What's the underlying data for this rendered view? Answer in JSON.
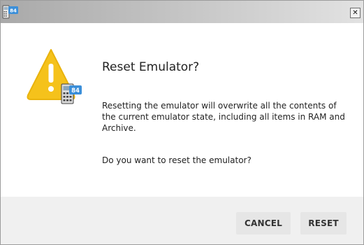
{
  "window": {
    "app_icon": "ti-84-calculator-icon",
    "close_icon": "close-icon",
    "close_glyph": "✕"
  },
  "dialog": {
    "icon": "warning-triangle-with-calculator-icon",
    "calculator_badge": "84",
    "title": "Reset Emulator?",
    "message": "Resetting the emulator will overwrite all the contents of the current emulator state, including all items in RAM and Archive.",
    "question": "Do you want to reset the emulator?"
  },
  "buttons": {
    "cancel_label": "CANCEL",
    "reset_label": "RESET"
  },
  "colors": {
    "warning_yellow": "#f5c21b",
    "footer_bg": "#f0f0f0",
    "button_bg": "#e6e6e6",
    "badge_blue": "#3b8fd9"
  }
}
